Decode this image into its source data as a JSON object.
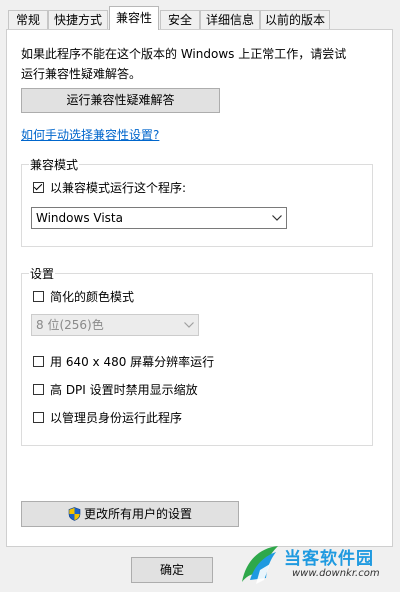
{
  "tabs": [
    {
      "label": "常规",
      "active": false
    },
    {
      "label": "快捷方式",
      "active": false
    },
    {
      "label": "兼容性",
      "active": true
    },
    {
      "label": "安全",
      "active": false
    },
    {
      "label": "详细信息",
      "active": false
    },
    {
      "label": "以前的版本",
      "active": false
    }
  ],
  "intro_text": "如果此程序不能在这个版本的 Windows 上正常工作，请尝试运行兼容性疑难解答。",
  "troubleshooter_button": "运行兼容性疑难解答",
  "manual_link": "如何手动选择兼容性设置?",
  "compat_mode": {
    "title": "兼容模式",
    "checkbox_label": "以兼容模式运行这个程序:",
    "checked": true,
    "selected_os": "Windows Vista"
  },
  "settings": {
    "title": "设置",
    "reduced_color_label": "简化的颜色模式",
    "color_depth_value": "8 位(256)色",
    "res_640_label": "用 640 x 480 屏幕分辨率运行",
    "high_dpi_label": "高 DPI 设置时禁用显示缩放",
    "run_as_admin_label": "以管理员身份运行此程序"
  },
  "change_all_users_button": "更改所有用户的设置",
  "ok_button": "确定",
  "watermark": {
    "brand": "当客软件园",
    "url": "www.downkr.com"
  },
  "colors": {
    "link": "#0066cc",
    "watermark_blue": "#1f9ae0"
  }
}
